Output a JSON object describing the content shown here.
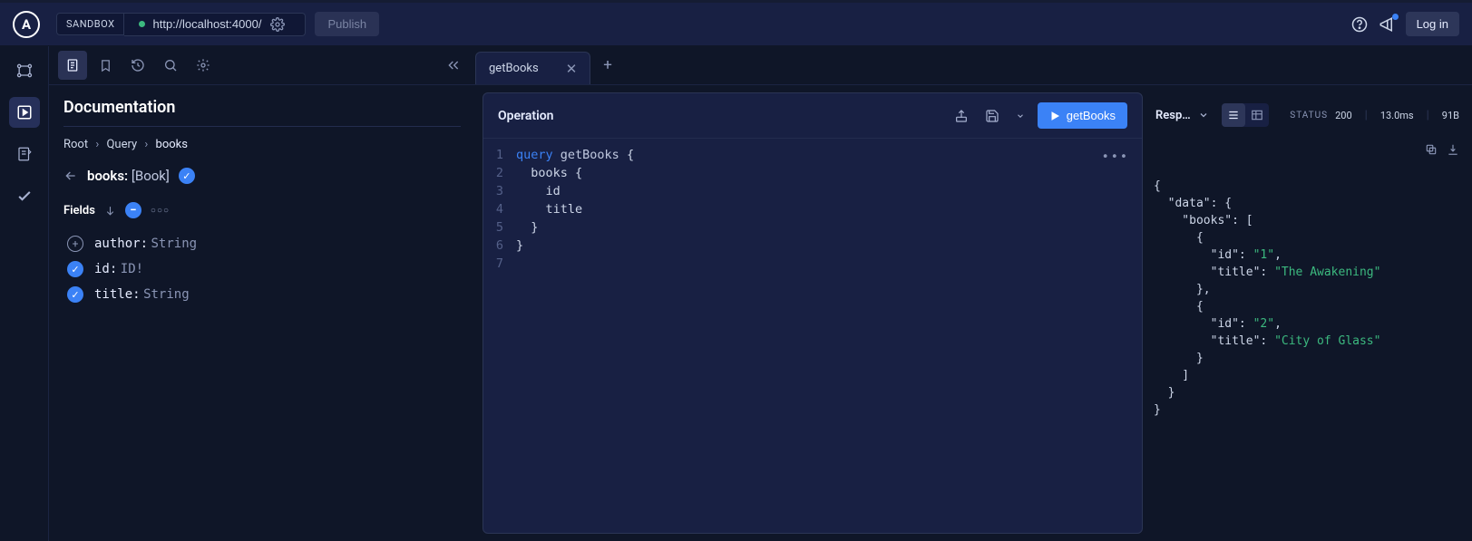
{
  "header": {
    "logo_letter": "A",
    "badge": "SANDBOX",
    "url": "http://localhost:4000/",
    "publish_label": "Publish",
    "login_label": "Log in"
  },
  "docs": {
    "title": "Documentation",
    "breadcrumb": [
      "Root",
      "Query",
      "books"
    ],
    "type_name": "books:",
    "type_return": "[Book]",
    "fields_label": "Fields",
    "fields": [
      {
        "checked": false,
        "name": "author:",
        "type": "String"
      },
      {
        "checked": true,
        "name": "id:",
        "type": "ID!"
      },
      {
        "checked": true,
        "name": "title:",
        "type": "String"
      }
    ]
  },
  "tabs": {
    "active": "getBooks"
  },
  "operation": {
    "title": "Operation",
    "run_label": "getBooks",
    "line_numbers": [
      "1",
      "2",
      "3",
      "4",
      "5",
      "6",
      "7"
    ],
    "code": {
      "l1_kw": "query",
      "l1_fn": "getBooks",
      "l1_brace": " {",
      "l2": "  books {",
      "l3": "    id",
      "l4": "    title",
      "l5": "  }",
      "l6": "}",
      "l7": ""
    }
  },
  "response": {
    "label": "Resp…",
    "status_label": "STATUS",
    "status_code": "200",
    "time": "13.0ms",
    "size": "91B",
    "json": {
      "l1": "{",
      "l2": "  \"data\": {",
      "l3": "    \"books\": [",
      "l4": "      {",
      "l5a": "        \"id\": ",
      "l5b": "\"1\"",
      "l5c": ",",
      "l6a": "        \"title\": ",
      "l6b": "\"The Awakening\"",
      "l7": "      },",
      "l8": "      {",
      "l9a": "        \"id\": ",
      "l9b": "\"2\"",
      "l9c": ",",
      "l10a": "        \"title\": ",
      "l10b": "\"City of Glass\"",
      "l11": "      }",
      "l12": "    ]",
      "l13": "  }",
      "l14": "}"
    }
  }
}
